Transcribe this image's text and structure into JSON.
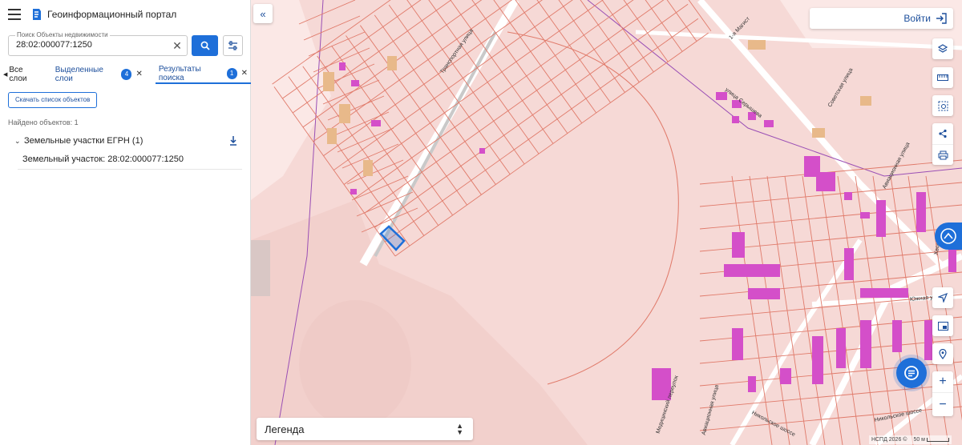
{
  "app": {
    "title": "Геоинформационный портал"
  },
  "search": {
    "label": "Поиск Объекты недвижимости",
    "value": "28:02:000077:1250"
  },
  "tabs": [
    {
      "label": "Все слои"
    },
    {
      "label": "Выделенные слои",
      "count": "4"
    },
    {
      "label": "Результаты поиска",
      "count": "1"
    }
  ],
  "results": {
    "download_label": "Скачать список объектов",
    "found_text": "Найдено объектов: 1",
    "group_title": "Земельные участки ЕГРН (1)",
    "item_label": "Земельный участок: 28:02:000077:1250"
  },
  "map": {
    "login_label": "Войти",
    "legend_label": "Легенда",
    "attribution": "НСПД 2026 ©",
    "scale_label": "50 м",
    "streets": [
      "Транспортная улица",
      "улица Серышева",
      "Советская улица",
      "Авиационная улица",
      "Авиационная улица",
      "Никольское шоссе",
      "Никольское шоссе",
      "Медицинский переулок",
      "Южная ули",
      "Хвостенко",
      "1-я Магист"
    ],
    "colors": {
      "map_background": "#f6d9d6",
      "parcel_line": "#e07a6a",
      "building": "#d44fc9",
      "selected_parcel": "#1e6fd9",
      "accent": "#1e6fd9"
    }
  },
  "icons": {
    "menu": "menu-icon",
    "logo": "logo-icon",
    "search": "search-icon",
    "filter": "sliders-icon",
    "collapse": "double-chevron-left-icon",
    "login": "login-icon",
    "tools": [
      "layers-icon",
      "ruler-icon",
      "select-area-icon",
      "share-icon",
      "print-icon",
      "navigate-icon",
      "picture-in-picture-icon",
      "geolocation-icon",
      "zoom-in-icon",
      "zoom-out-icon"
    ],
    "assistant": "assistant-icon",
    "chat": "chat-icon"
  }
}
